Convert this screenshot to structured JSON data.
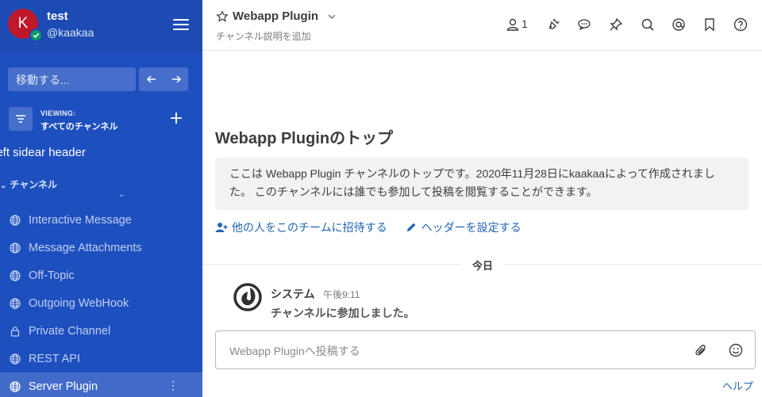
{
  "team": {
    "avatar_letter": "K",
    "name": "test",
    "username": "@kaakaa"
  },
  "sidebar": {
    "jump_placeholder": "移動する...",
    "viewing_label": "VIEWING:",
    "viewing_value": "すべてのチャンネル",
    "custom_header": "left sidear header",
    "group_label": "チャンネル",
    "channels": [
      {
        "label": "Interactive Message",
        "icon": "globe-icon"
      },
      {
        "label": "Message Attachments",
        "icon": "globe-icon"
      },
      {
        "label": "Off-Topic",
        "icon": "globe-icon"
      },
      {
        "label": "Outgoing WebHook",
        "icon": "globe-icon"
      },
      {
        "label": "Private Channel",
        "icon": "lock-icon"
      },
      {
        "label": "REST API",
        "icon": "globe-icon"
      },
      {
        "label": "Server Plugin",
        "icon": "globe-icon",
        "active": true
      }
    ]
  },
  "header": {
    "channel_name": "Webapp Plugin",
    "description": "チャンネル説明を追加",
    "member_count": "1"
  },
  "intro": {
    "title": "Webapp Pluginのトップ",
    "body": "ここは Webapp Plugin チャンネルのトップです。2020年11月28日にkaakaaによって作成されました。 このチャンネルには誰でも参加して投稿を閲覧することができます。",
    "invite_label": "他の人をこのチームに招待する",
    "header_label": "ヘッダーを設定する"
  },
  "date_separator": "今日",
  "post": {
    "author": "システム",
    "time": "午後9:11",
    "message": "チャンネルに参加しました。"
  },
  "composer": {
    "placeholder": "Webapp Pluginへ投稿する"
  },
  "help_label": "ヘルプ",
  "colors": {
    "sidebar_bg": "#1e4fbf",
    "link": "#2164b3",
    "avatar": "#c0182a",
    "online": "#0a9b68"
  }
}
